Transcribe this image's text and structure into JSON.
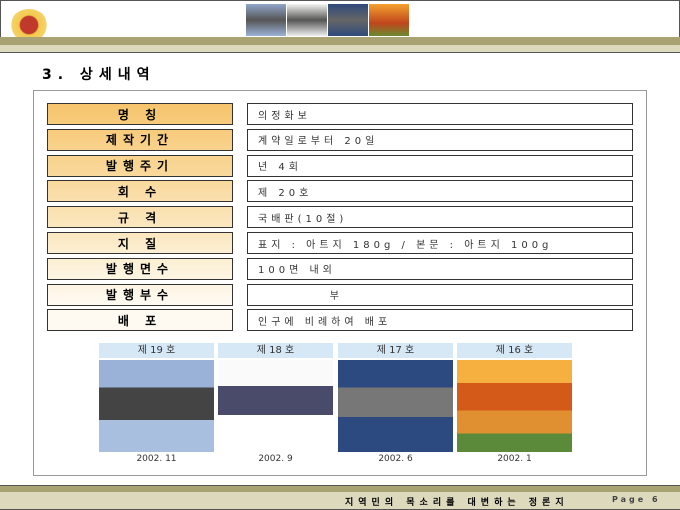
{
  "title": "3. 상세내역",
  "rows": [
    {
      "label": "명 칭",
      "value": "의정화보"
    },
    {
      "label": "제작기간",
      "value": "계약일로부터 20일"
    },
    {
      "label": "발행주기",
      "value": "년 4회"
    },
    {
      "label": "회 수",
      "value": "제 20호"
    },
    {
      "label": "규 격",
      "value": "국배판(10절)"
    },
    {
      "label": "지 질",
      "value": "표지 : 아트지 180g / 본문 : 아트지 100g"
    },
    {
      "label": "발행면수",
      "value": "100면 내외"
    },
    {
      "label": "발행부수",
      "value": "          부"
    },
    {
      "label": "배 포",
      "value": "인구에 비례하여 배포"
    }
  ],
  "covers": [
    {
      "issue": "제 19 호",
      "date": "2002. 11"
    },
    {
      "issue": "제 18 호",
      "date": "2002. 9"
    },
    {
      "issue": "제 17 호",
      "date": "2002. 6"
    },
    {
      "issue": "제 16 호",
      "date": "2002. 1"
    }
  ],
  "footer": {
    "slogan": "지역민의 목소리를 대변하는 정론지",
    "page": "Page 6"
  }
}
